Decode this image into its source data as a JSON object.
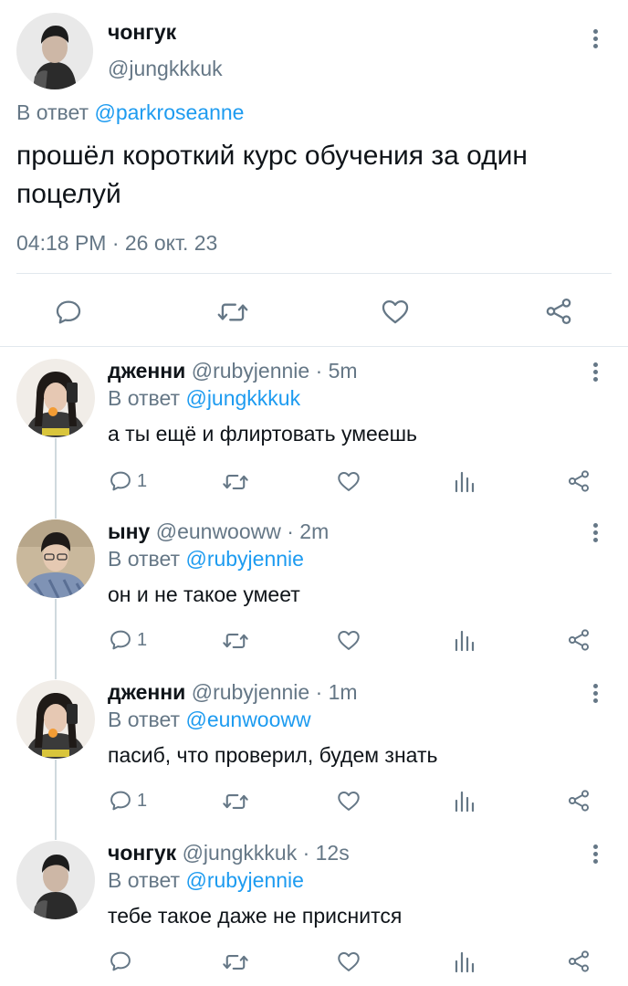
{
  "main_tweet": {
    "name": "чонгук",
    "handle": "@jungkkkuk",
    "reply_prefix": "В ответ",
    "reply_mention": "@parkroseanne",
    "text": "прошёл короткий курс обучения за один поцелуй",
    "timestamp": "04:18 PM · 26 окт. 23",
    "actions": [
      "reply-icon",
      "retweet-icon",
      "like-icon",
      "share-icon"
    ]
  },
  "replies": [
    {
      "name": "дженни",
      "handle": "@rubyjennie",
      "time": "· 5m",
      "reply_prefix": "В ответ",
      "reply_mention": "@jungkkkuk",
      "text": "а ты ещё и флиртовать умеешь",
      "reply_count": "1"
    },
    {
      "name": "ыну",
      "handle": "@eunwooww",
      "time": "· 2m",
      "reply_prefix": "В ответ",
      "reply_mention": "@rubyjennie",
      "text": "он и не такое умеет",
      "reply_count": "1"
    },
    {
      "name": "дженни",
      "handle": "@rubyjennie",
      "time": "· 1m",
      "reply_prefix": "В ответ",
      "reply_mention": "@eunwooww",
      "text": "пасиб, что проверил, будем знать",
      "reply_count": "1"
    },
    {
      "name": "чонгук",
      "handle": "@jungkkkuk",
      "time": "· 12s",
      "reply_prefix": "В ответ",
      "reply_mention": "@rubyjennie",
      "text": "тебе такое даже не приснится",
      "reply_count": ""
    }
  ],
  "colors": {
    "link": "#1d9bf0",
    "secondary_text": "#657786",
    "primary_text": "#0f1419",
    "divider": "#e1e8ed"
  }
}
